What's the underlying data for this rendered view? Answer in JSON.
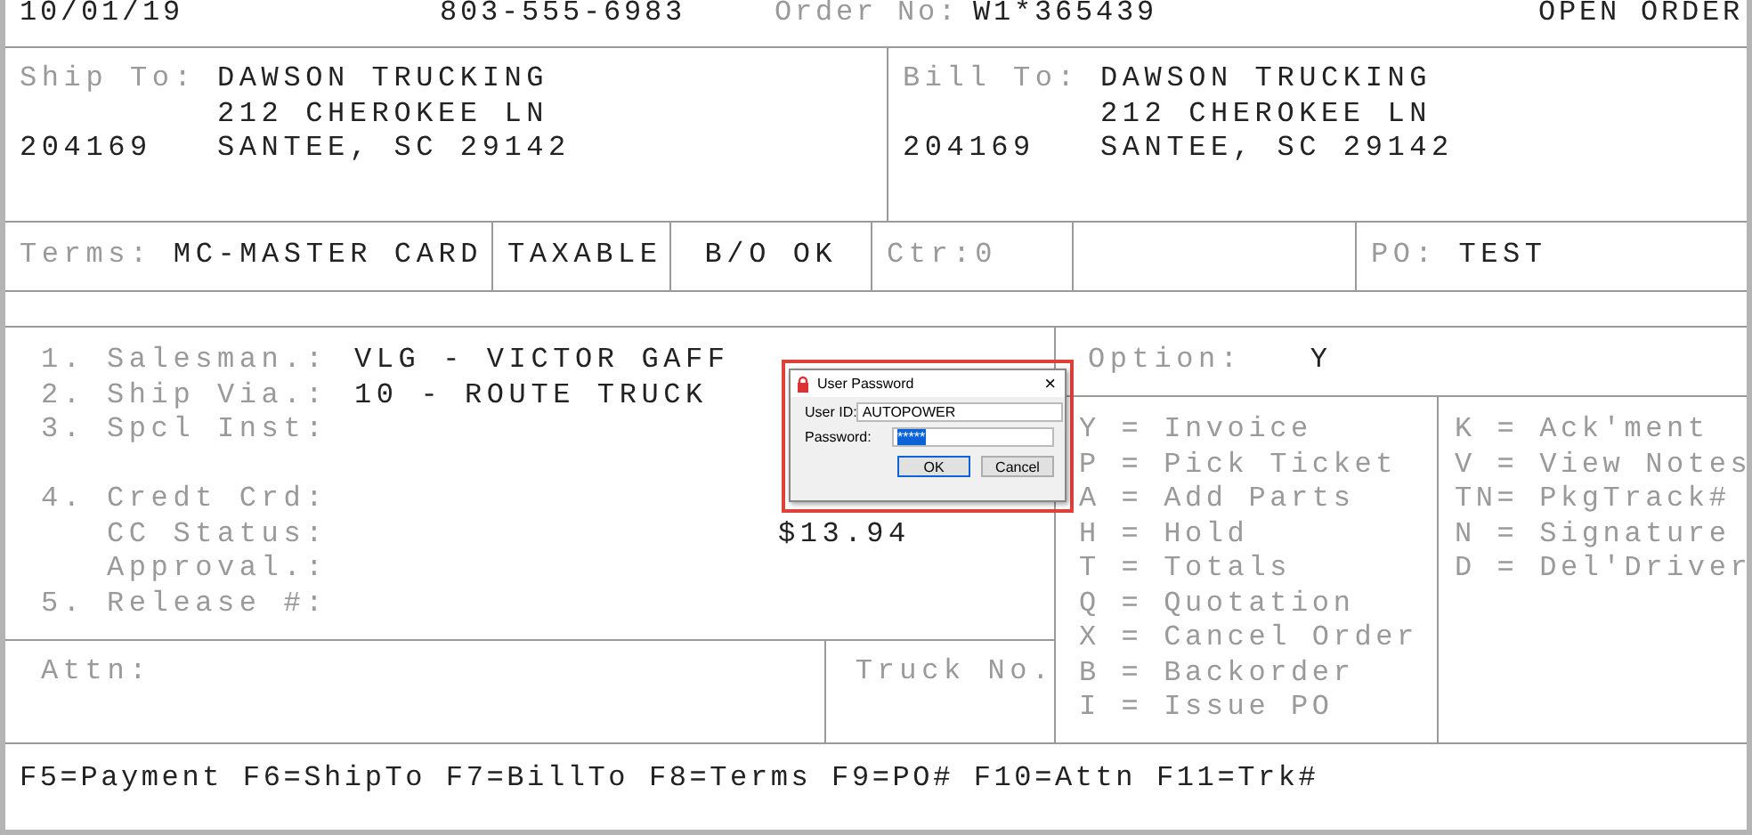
{
  "header": {
    "date": "10/01/19",
    "phone": "803-555-6983",
    "order_label": "Order No:",
    "order_no": "W1*365439",
    "status": "OPEN ORDER"
  },
  "ship_to": {
    "label": "Ship To:",
    "name": "DAWSON TRUCKING",
    "street": "212 CHEROKEE LN",
    "account": "204169",
    "city": "SANTEE, SC 29142"
  },
  "bill_to": {
    "label": "Bill To:",
    "name": "DAWSON TRUCKING",
    "street": "212 CHEROKEE LN",
    "account": "204169",
    "city": "SANTEE, SC 29142"
  },
  "terms": {
    "label": "Terms:",
    "value": "MC-MASTER CARD",
    "taxable": "TAXABLE",
    "backorder": "B/O OK",
    "counter": "Ctr:0",
    "po_label": "PO:",
    "po_value": "TEST"
  },
  "fields": [
    {
      "number": "1.",
      "label": "Salesman.:",
      "value": "VLG - VICTOR GAFF"
    },
    {
      "number": "2.",
      "label": "Ship Via.:",
      "value": "10 - ROUTE TRUCK"
    },
    {
      "number": "3.",
      "label": "Spcl Inst:"
    },
    {
      "number": "4.",
      "label": "Credt Crd:"
    },
    {
      "label": "CC Status:",
      "amount": "$13.94"
    },
    {
      "label": "Approval.:"
    },
    {
      "number": "5.",
      "label": "Release #:"
    }
  ],
  "attn": {
    "label": "Attn:"
  },
  "truck": {
    "label": "Truck No."
  },
  "option": {
    "label": "Option:",
    "value": "Y"
  },
  "options_left": [
    "Y = Invoice",
    "P = Pick Ticket",
    "A = Add Parts",
    "H = Hold",
    "T = Totals",
    "Q = Quotation",
    "X = Cancel Order",
    "B = Backorder",
    "I = Issue PO"
  ],
  "options_right": [
    "K = Ack'ment",
    "V = View Notes",
    "TN= PkgTrack#",
    "N = Signature",
    "D = Del'Driver"
  ],
  "function_keys": "F5=Payment F6=ShipTo F7=BillTo F8=Terms F9=PO# F10=Attn F11=Trk#",
  "dialog": {
    "title": "User Password",
    "close": "×",
    "user_id_label": "User ID:",
    "user_id": "AUTOPOWER",
    "password_label": "Password:",
    "password": "*****",
    "password_selected": true,
    "ok": "OK",
    "cancel": "Cancel"
  }
}
